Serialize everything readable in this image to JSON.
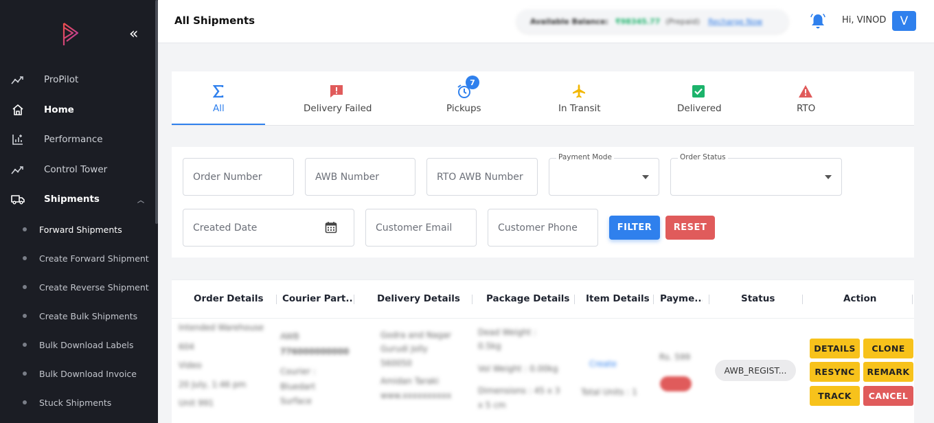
{
  "sidebar": {
    "nav": [
      {
        "label": "ProPilot",
        "icon": "trend-icon"
      },
      {
        "label": "Home",
        "icon": "home-icon"
      },
      {
        "label": "Performance",
        "icon": "chart-icon"
      },
      {
        "label": "Control Tower",
        "icon": "trend-icon"
      },
      {
        "label": "Shipments",
        "icon": "truck-icon"
      }
    ],
    "sub_items": [
      "Forward Shipments",
      "Create Forward Shipment",
      "Create Reverse Shipment",
      "Create Bulk Shipments",
      "Bulk Download Labels",
      "Bulk Download Invoice",
      "Stuck Shipments"
    ],
    "collapse_glyph": "«"
  },
  "header": {
    "title": "All Shipments",
    "balance_label": "Available Balance:",
    "balance_value": "₹98345.77",
    "balance_mode": "(Prepaid)",
    "recharge_link": "Recharge Now",
    "greeting": "Hi, VINOD",
    "avatar_initial": "V"
  },
  "tabs": [
    {
      "label": "All",
      "icon": "sigma-icon"
    },
    {
      "label": "Delivery Failed",
      "icon": "alert-message-icon"
    },
    {
      "label": "Pickups",
      "icon": "alarm-clock-icon",
      "badge": "7"
    },
    {
      "label": "In Transit",
      "icon": "airplane-icon"
    },
    {
      "label": "Delivered",
      "icon": "check-square-icon"
    },
    {
      "label": "RTO",
      "icon": "warning-triangle-icon"
    }
  ],
  "filters": {
    "order_number": "Order Number",
    "awb_number": "AWB Number",
    "rto_awb_number": "RTO AWB Number",
    "payment_mode_label": "Payment Mode",
    "order_status_label": "Order Status",
    "created_date": "Created Date",
    "customer_email": "Customer Email",
    "customer_phone": "Customer Phone",
    "filter_button": "FILTER",
    "reset_button": "RESET"
  },
  "table": {
    "columns": [
      "Order Details",
      "Courier Part...",
      "Delivery Details",
      "Package Details",
      "Item Details",
      "Payme...",
      "Status",
      "Action"
    ],
    "row": {
      "order_details": [
        "Intended Warehouse",
        "604",
        "Video",
        "20 July, 1:46 pm",
        "Unit 991"
      ],
      "courier": [
        "AWB",
        "776000000000",
        "Courier :",
        "Bluedart",
        "Surface"
      ],
      "delivery": [
        "Godra and Nagar",
        "Gurudi Jolly",
        "560050",
        "Amidan Taraki",
        "www.xxxxxxxxxx"
      ],
      "package": [
        "Dead Weight :",
        "0.5kg",
        "Vol Weight : 0.00kg",
        "Dimensions : 45 x 3",
        "x 5 cm"
      ],
      "item": [
        "Create",
        "Total Units : 1"
      ],
      "payment": "Rs. 599",
      "status": "AWB_REGIST...",
      "actions": [
        "DETAILS",
        "CLONE",
        "RESYNC",
        "REMARK",
        "TRACK",
        "CANCEL"
      ]
    }
  },
  "colors": {
    "sidebar_bg": "#1b1d24",
    "accent": "#2f80ed",
    "danger": "#e05b5b",
    "warning": "#f7c21b",
    "success": "#1cb36b"
  }
}
